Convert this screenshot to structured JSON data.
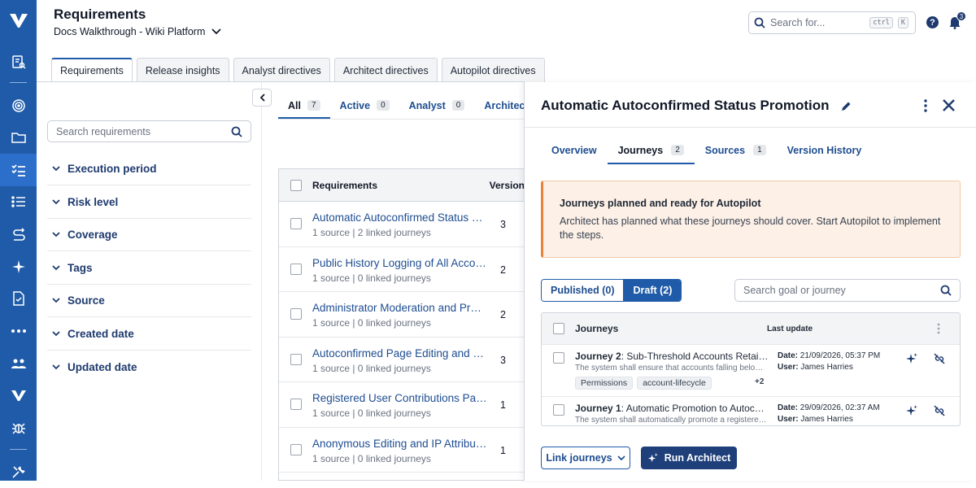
{
  "header": {
    "title": "Requirements",
    "project": "Docs Walkthrough - Wiki Platform",
    "search_placeholder": "Search for...",
    "kbd_ctrl": "ctrl",
    "kbd_k": "K",
    "notifications_count": "3"
  },
  "tabs": [
    "Requirements",
    "Release insights",
    "Analyst directives",
    "Architect directives",
    "Autopilot directives"
  ],
  "left_panel": {
    "search_placeholder": "Search requirements",
    "filters": [
      "Execution period",
      "Risk level",
      "Coverage",
      "Tags",
      "Source",
      "Created date",
      "Updated date"
    ]
  },
  "middle": {
    "tabs": [
      {
        "label": "All",
        "count": "7"
      },
      {
        "label": "Active",
        "count": "0"
      },
      {
        "label": "Analyst",
        "count": "0"
      },
      {
        "label": "Architect",
        "count": ""
      }
    ],
    "columns": {
      "requirements": "Requirements",
      "version": "Version"
    },
    "rows": [
      {
        "title": "Automatic Autoconfirmed Status Promotion",
        "sub": "1 source | 2 linked journeys",
        "version": "3"
      },
      {
        "title": "Public History Logging of All Account Actions",
        "sub": "1 source | 0 linked journeys",
        "version": "2"
      },
      {
        "title": "Administrator Moderation and Protection",
        "sub": "1 source | 0 linked journeys",
        "version": "2"
      },
      {
        "title": "Autoconfirmed Page Editing and Moving",
        "sub": "1 source | 0 linked journeys",
        "version": "3"
      },
      {
        "title": "Registered User Contributions Page",
        "sub": "1 source | 0 linked journeys",
        "version": "1"
      },
      {
        "title": "Anonymous Editing and IP Attribution",
        "sub": "1 source | 0 linked journeys",
        "version": "1"
      }
    ]
  },
  "drawer": {
    "title": "Automatic Autoconfirmed Status Promotion",
    "tabs": [
      {
        "label": "Overview",
        "count": ""
      },
      {
        "label": "Journeys",
        "count": "2"
      },
      {
        "label": "Sources",
        "count": "1"
      },
      {
        "label": "Version History",
        "count": ""
      }
    ],
    "alert": {
      "title": "Journeys planned and ready for Autopilot",
      "body": "Architect has planned what these journeys should cover. Start Autopilot to implement the steps."
    },
    "segments": {
      "published": "Published (0)",
      "draft": "Draft (2)"
    },
    "search_placeholder": "Search goal or journey",
    "journeys_header": {
      "name": "Journeys",
      "last_update": "Last update"
    },
    "journeys": [
      {
        "label": "Journey 2",
        "title": ": Sub-Threshold Accounts Retain Restricted Permissions",
        "desc": "The system shall ensure that accounts falling below the threshold keep restricted permissions",
        "chips": [
          "Permissions",
          "account-lifecycle"
        ],
        "more": "+2",
        "date_label": "Date:",
        "date": " 21/09/2026, 05:37 PM",
        "user_label": "User:",
        "user": " James Harries"
      },
      {
        "label": "Journey 1",
        "title": ": Automatic Promotion to Autoconfirmed Status",
        "desc": "The system shall automatically promote a registered account to autoconfirmed status",
        "chips": [],
        "more": "",
        "date_label": "Date:",
        "date": " 29/09/2026, 02:37 AM",
        "user_label": "User:",
        "user": " James Harries"
      }
    ],
    "link_button": "Link journeys",
    "run_button": "Run Architect"
  },
  "colors": {
    "rail": "#1f5ba8",
    "accent": "#1e3f7a",
    "link": "#1e4d91",
    "alert_border": "#e8833a"
  }
}
